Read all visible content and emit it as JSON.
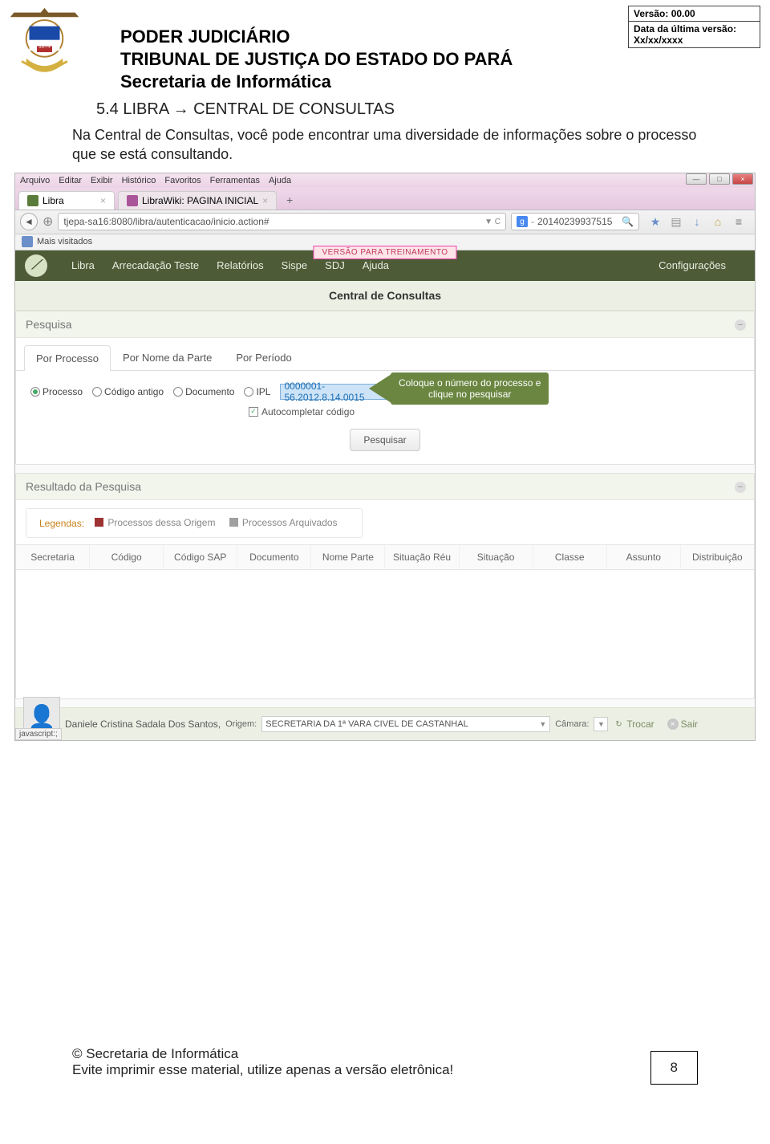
{
  "doc": {
    "org1": "PODER JUDICIÁRIO",
    "org2": "TRIBUNAL DE JUSTIÇA DO ESTADO DO PARÁ",
    "org3": "Secretaria de Informática",
    "version_label": "Versão: 00.00",
    "date_label": "Data da última versão: Xx/xx/xxxx",
    "section_title": "5.4 LIBRA → CENTRAL DE CONSULTAS",
    "section_body": "Na Central de Consultas, você pode encontrar uma diversidade de informações sobre o processo que se está consultando.",
    "footer_copyright": "© Secretaria de Informática",
    "footer_eco": "Evite imprimir esse material, utilize apenas a versão eletrônica!",
    "page_number": "8"
  },
  "browser": {
    "menu": {
      "arquivo": "Arquivo",
      "editar": "Editar",
      "exibir": "Exibir",
      "historico": "Histórico",
      "favoritos": "Favoritos",
      "ferramentas": "Ferramentas",
      "ajuda": "Ajuda"
    },
    "tab1": "Libra",
    "tab2": "LibraWiki: PAGINA INICIAL",
    "url": "tjepa-sa16:8080/libra/autenticacao/inicio.action#",
    "refresh": "C",
    "search_value": "20140239937515",
    "bookmark": "Mais visitados",
    "status": "javascript:;"
  },
  "app": {
    "nav": {
      "libra": "Libra",
      "arrecadacao": "Arrecadação Teste",
      "relatorios": "Relatórios",
      "sispe": "Sispe",
      "sdj": "SDJ",
      "ajuda": "Ajuda",
      "config": "Configurações"
    },
    "badge": "VERSÃO PARA TREINAMENTO",
    "page_title": "Central de Consultas",
    "pesquisa": {
      "title": "Pesquisa",
      "tabs": {
        "por_processo": "Por Processo",
        "por_nome": "Por Nome da Parte",
        "por_periodo": "Por Período"
      },
      "radios": {
        "processo": "Processo",
        "codigo": "Código antigo",
        "documento": "Documento",
        "ipl": "IPL"
      },
      "input_value": "0000001-56.2012.8.14.0015",
      "callout_l1": "Coloque o número do processo e",
      "callout_l2": "clique no pesquisar",
      "autocomplete": "Autocompletar código",
      "search_btn": "Pesquisar"
    },
    "resultado": {
      "title": "Resultado da Pesquisa",
      "legend_label": "Legendas:",
      "legend1": "Processos dessa Origem",
      "legend2": "Processos Arquivados",
      "cols": {
        "secretaria": "Secretaria",
        "codigo": "Código",
        "codigo_sap": "Código SAP",
        "documento": "Documento",
        "nome": "Nome Parte",
        "situ_reu": "Situação Réu",
        "situ": "Situação",
        "classe": "Classe",
        "assunto": "Assunto",
        "distrib": "Distribuição"
      }
    },
    "footer": {
      "user": "Daniele Cristina Sadala Dos Santos,",
      "origem_label": "Origem:",
      "origem_value": "SECRETARIA DA 1ª VARA CIVEL DE CASTANHAL",
      "camara_label": "Câmara:",
      "trocar": "Trocar",
      "sair": "Sair"
    }
  }
}
